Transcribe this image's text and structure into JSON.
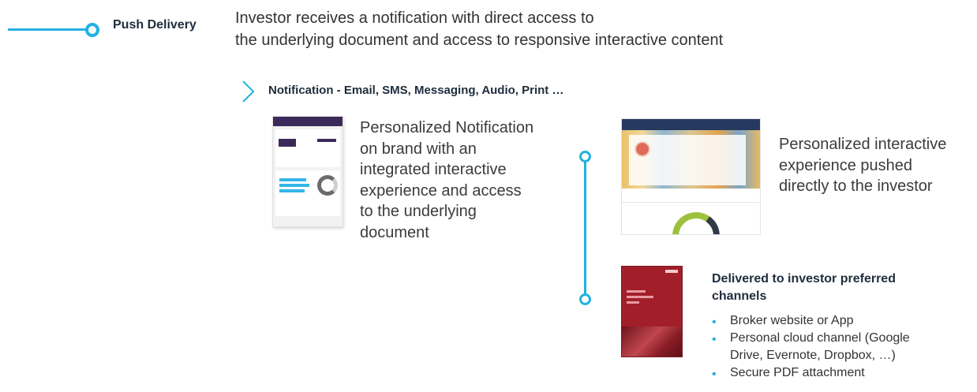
{
  "header": {
    "label": "Push Delivery",
    "description_line1": "Investor receives a notification with direct access to",
    "description_line2": "the underlying document and access to responsive interactive content"
  },
  "notification": {
    "label": "Notification - Email, SMS, Messaging, Audio, Print …"
  },
  "email_block": {
    "lines": [
      "Personalized Notification",
      "on brand with an",
      "integrated interactive",
      "experience and access",
      "to the underlying",
      "document"
    ]
  },
  "web_block": {
    "lines": [
      "Personalized interactive",
      "experience pushed",
      "directly to the investor"
    ]
  },
  "delivery_block": {
    "title_line1": "Delivered to investor preferred",
    "title_line2": "channels",
    "items": [
      "Broker website or App",
      "Personal cloud channel (Google",
      "Drive, Evernote, Dropbox, …)",
      "Secure PDF attachment"
    ]
  },
  "colors": {
    "accent": "#23b1e1",
    "heading": "#1e2d3d",
    "body": "#3b3b3b"
  }
}
